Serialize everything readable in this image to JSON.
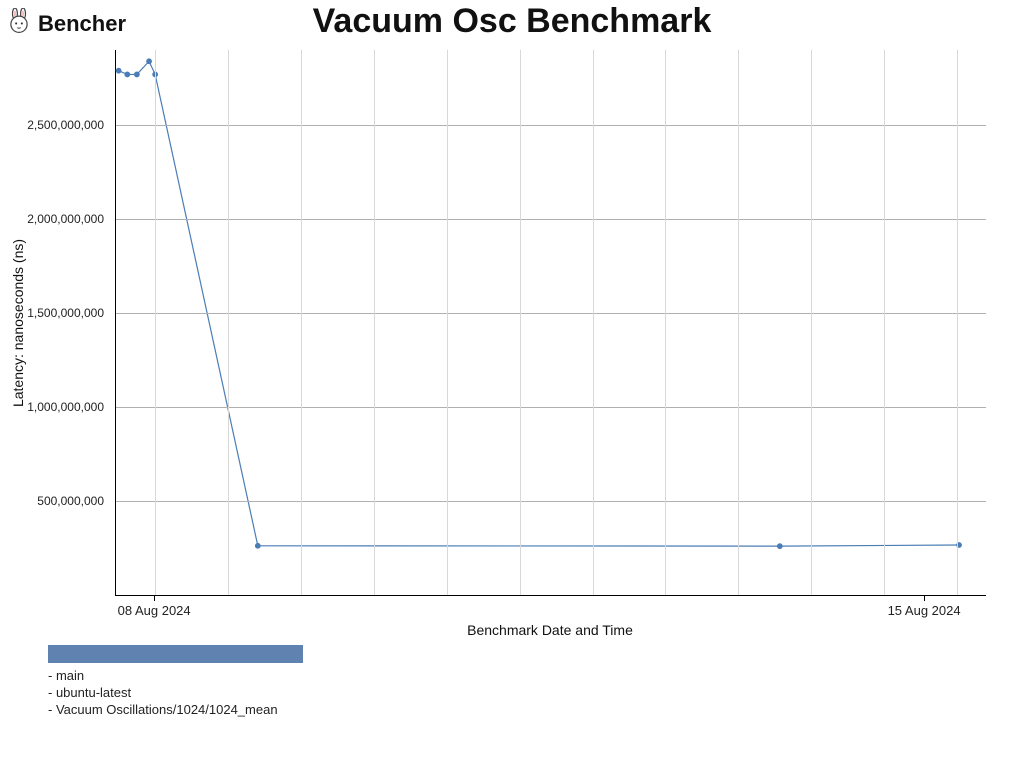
{
  "brand": "Bencher",
  "chart_data": {
    "type": "line",
    "title": "Vacuum Osc Benchmark",
    "xlabel": "Benchmark Date and Time",
    "ylabel": "Latency: nanoseconds (ns)",
    "ylim": [
      0,
      2900000000
    ],
    "ytick_values": [
      500000000,
      1000000000,
      1500000000,
      2000000000,
      2500000000
    ],
    "ytick_labels": [
      "500,000,000",
      "1,000,000,000",
      "1,500,000,000",
      "2,000,000,000",
      "2,500,000,000"
    ],
    "xtick_labels": [
      "08 Aug 2024",
      "15 Aug 2024"
    ],
    "xtick_positions": [
      4.5,
      93
    ],
    "series": [
      {
        "name": "main / ubuntu-latest / Vacuum Oscillations/1024/1024_mean",
        "x_pct": [
          0.3,
          1.3,
          2.4,
          3.8,
          4.5,
          16.3,
          76.3,
          96.9
        ],
        "y": [
          2790000000,
          2770000000,
          2770000000,
          2840000000,
          2770000000,
          262000000,
          260000000,
          266000000
        ]
      }
    ],
    "legend": {
      "branch": "- main",
      "runner": "- ubuntu-latest",
      "bench": "- Vacuum Oscillations/1024/1024_mean"
    }
  }
}
